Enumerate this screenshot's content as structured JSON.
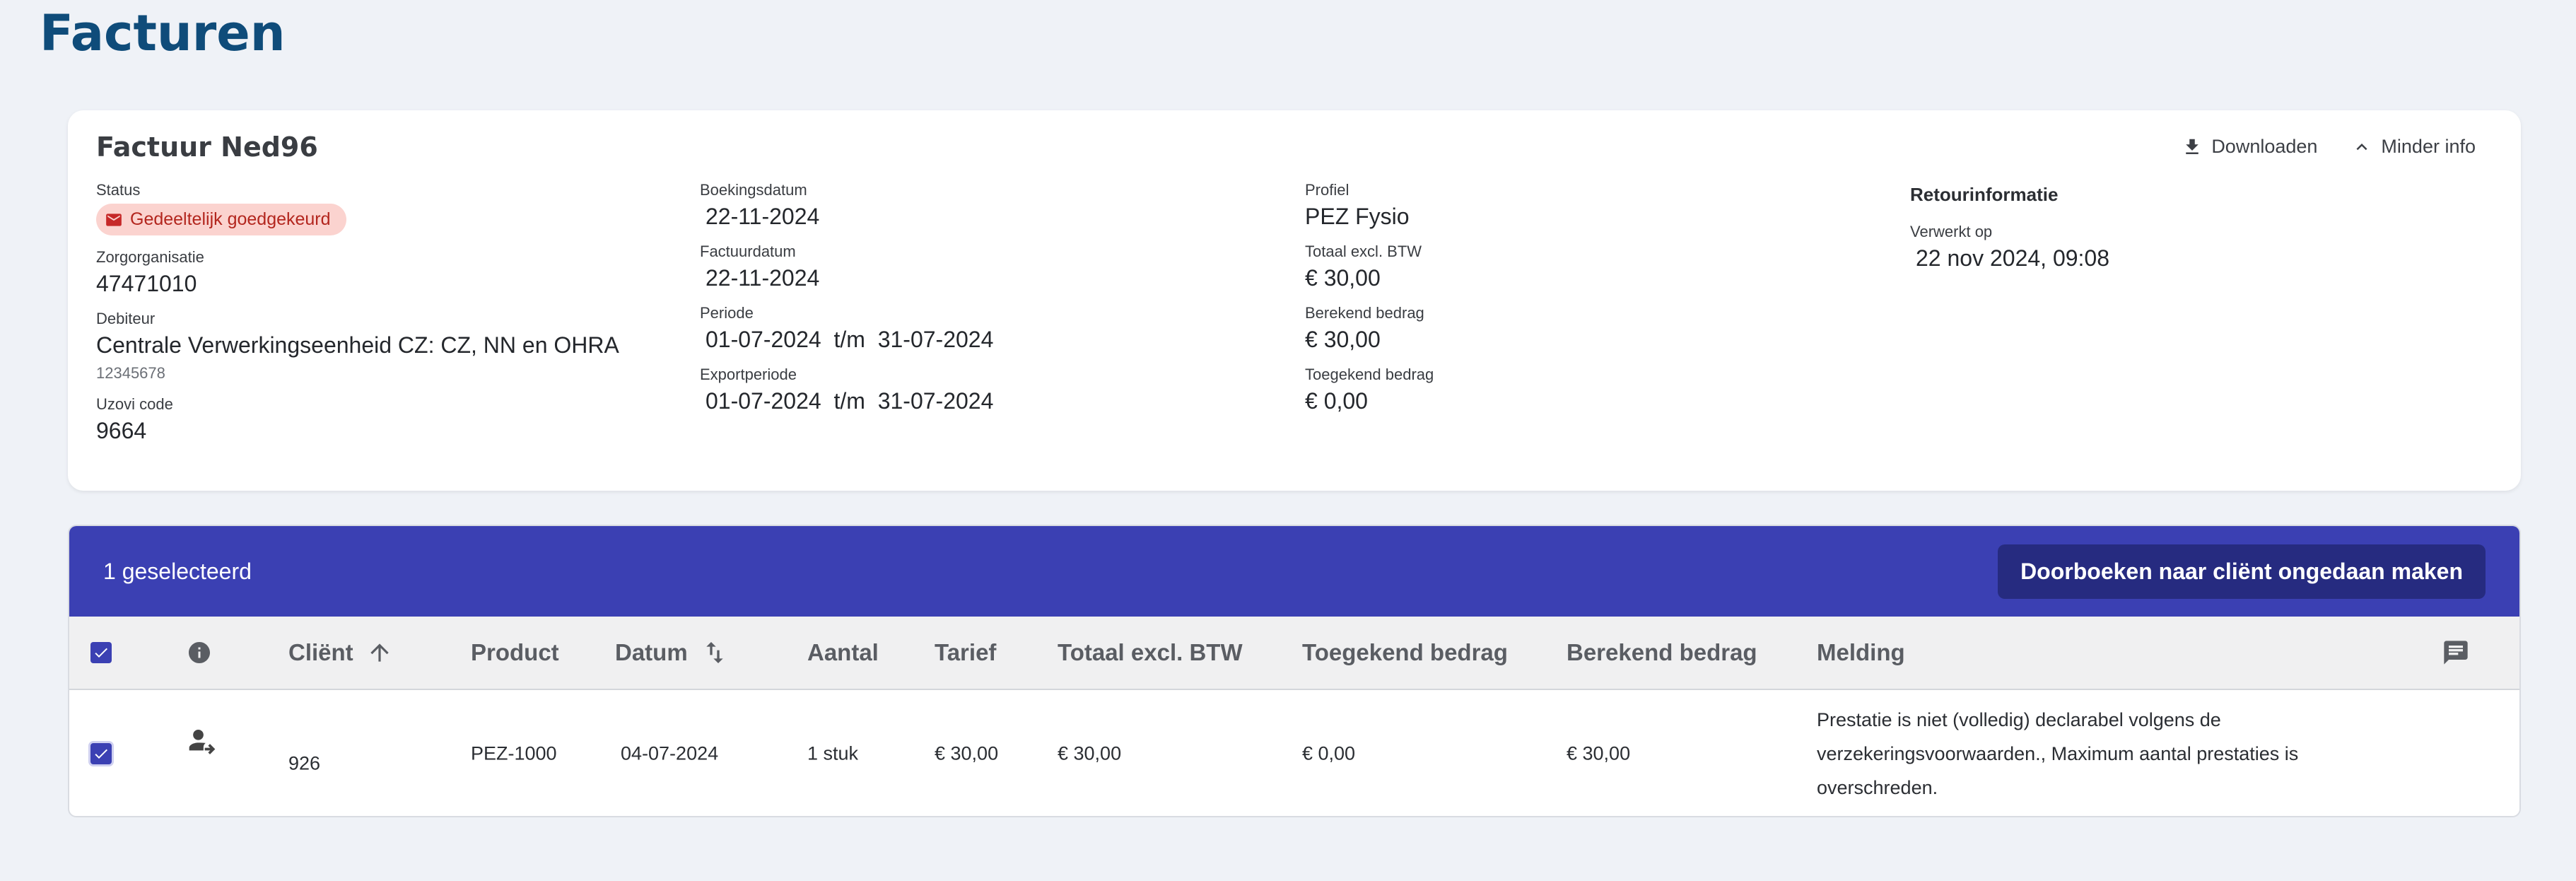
{
  "page": {
    "title": "Facturen"
  },
  "invoice": {
    "title": "Factuur Ned96",
    "actions": {
      "download": "Downloaden",
      "less_info": "Minder info"
    },
    "fields": {
      "status_label": "Status",
      "status_value": "Gedeeltelijk goedgekeurd",
      "zorg_label": "Zorgorganisatie",
      "zorg_value": "47471010",
      "debiteur_label": "Debiteur",
      "debiteur_value": "Centrale Verwerkingseenheid CZ: CZ, NN en OHRA",
      "debiteur_sub": "12345678",
      "uzovi_label": "Uzovi code",
      "uzovi_value": "9664",
      "boekingsdatum_label": "Boekingsdatum",
      "boekingsdatum_value": "22-11-2024",
      "factuurdatum_label": "Factuurdatum",
      "factuurdatum_value": "22-11-2024",
      "periode_label": "Periode",
      "periode_value": "01-07-2024  t/m  31-07-2024",
      "exportperiode_label": "Exportperiode",
      "exportperiode_value": "01-07-2024  t/m  31-07-2024",
      "profiel_label": "Profiel",
      "profiel_value": "PEZ Fysio",
      "totaal_label": "Totaal excl. BTW",
      "totaal_value": "€ 30,00",
      "berekend_label": "Berekend bedrag",
      "berekend_value": "€ 30,00",
      "toegekend_label": "Toegekend bedrag",
      "toegekend_value": "€ 0,00",
      "retour_title": "Retourinformatie",
      "verwerkt_label": "Verwerkt op",
      "verwerkt_value": "22 nov 2024, 09:08"
    },
    "status_color": "#b3261e"
  },
  "selection": {
    "count_text": "1 geselecteerd",
    "undo_button": "Doorboeken naar cliënt ongedaan maken"
  },
  "table": {
    "headers": {
      "client": "Cliënt",
      "product": "Product",
      "datum": "Datum",
      "aantal": "Aantal",
      "tarief": "Tarief",
      "totaal": "Totaal excl. BTW",
      "toegekend": "Toegekend bedrag",
      "berekend": "Berekend bedrag",
      "melding": "Melding"
    },
    "rows": [
      {
        "client": "926",
        "product": "PEZ-1000",
        "datum": "04-07-2024",
        "aantal": "1 stuk",
        "tarief": "€ 30,00",
        "totaal": "€ 30,00",
        "toegekend": "€ 0,00",
        "berekend": "€ 30,00",
        "melding": "Prestatie is niet (volledig) declarabel volgens de verzekeringsvoorwaarden., Maximum aantal prestaties is overschreden."
      }
    ]
  },
  "icons": [
    "download-icon",
    "chevron-up-icon",
    "mail-badge-icon",
    "info-icon",
    "arrow-up-icon",
    "sort-icon",
    "comment-icon",
    "person-transfer-icon",
    "checkbox-checked-icon"
  ],
  "colors": {
    "accent": "#3b40b3",
    "accent_dark": "#262b80",
    "title": "#0f4c7a",
    "warning": "#f5a623"
  }
}
